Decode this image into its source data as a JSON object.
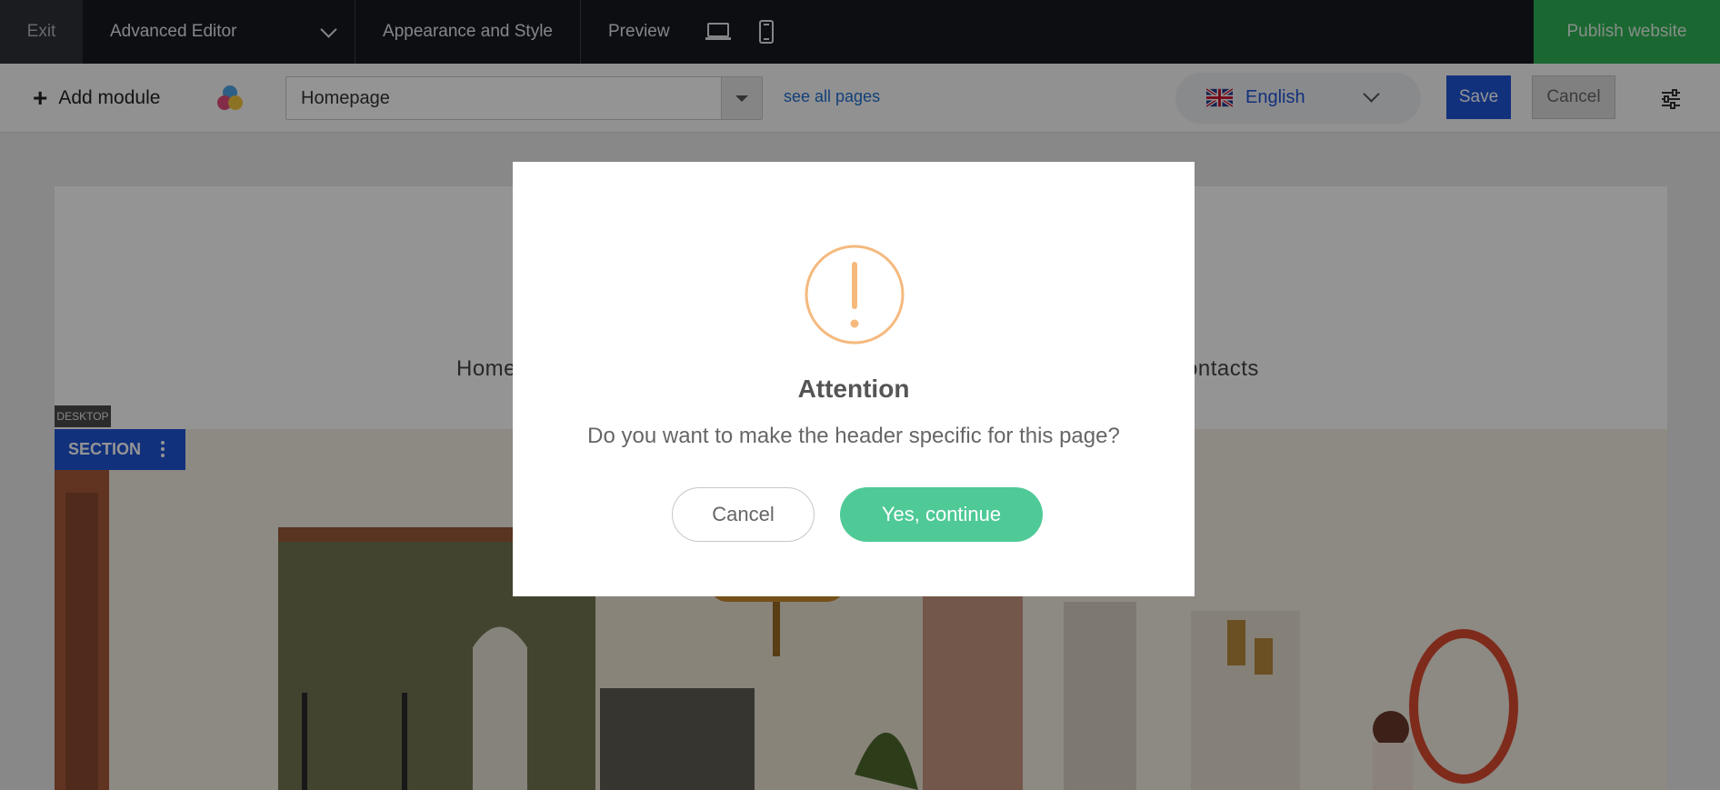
{
  "topbar": {
    "exit_label": "Exit",
    "editor_label": "Advanced Editor",
    "appearance_label": "Appearance and Style",
    "preview_label": "Preview",
    "publish_label": "Publish website"
  },
  "toolbar": {
    "add_module_label": "Add module",
    "page_select_value": "Homepage",
    "see_all_label": "see all pages",
    "language_label": "English",
    "save_label": "Save",
    "cancel_label": "Cancel"
  },
  "canvas": {
    "nav_home": "Home",
    "nav_contacts": "ontacts",
    "desktop_badge": "DESKTOP",
    "section_label": "SECTION"
  },
  "modal": {
    "title": "Attention",
    "message": "Do you want to make the header specific for this page?",
    "cancel_label": "Cancel",
    "confirm_label": "Yes, continue"
  },
  "colors": {
    "topbar_bg": "#15191f",
    "publish_green": "#2fb155",
    "primary_blue": "#1f55d6",
    "confirm_green": "#4fca97",
    "warning_orange": "#f5b97e"
  },
  "icons": [
    "plus-icon",
    "palette-icon",
    "dropdown-arrow-icon",
    "uk-flag-icon",
    "chevron-down-icon",
    "laptop-icon",
    "mobile-icon",
    "settings-sliders-icon",
    "more-vertical-icon",
    "warning-icon"
  ]
}
